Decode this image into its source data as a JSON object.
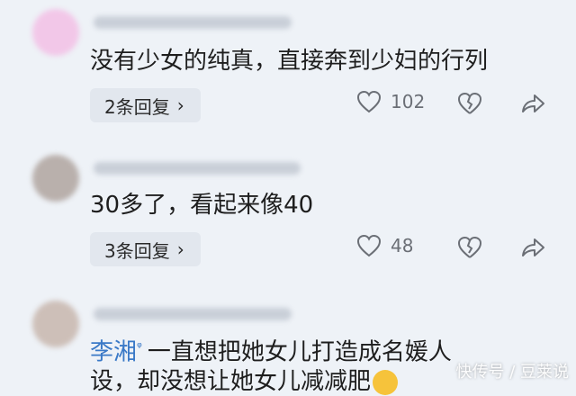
{
  "comments": [
    {
      "text": "没有少女的纯真，直接奔到少妇的行列",
      "reply_label": "2条回复",
      "likes": "102",
      "avatar_color": "#f2c7e8"
    },
    {
      "text": "30多了，看起来像40",
      "reply_label": "3条回复",
      "likes": "48",
      "avatar_color": "#b9b0ac"
    },
    {
      "username": "李湘",
      "badge": "ᵠ",
      "text_line1": "一直想把她女儿打造成名媛人",
      "text_line2": "设，却没想让她女儿减减肥",
      "avatar_color": "#cdbfb8"
    }
  ],
  "icons": {
    "like": "heart-outline-icon",
    "dislike": "broken-heart-icon",
    "share": "share-arrow-icon",
    "reply_chevron": "chevron-right-icon",
    "emoji": "laughing-emoji-icon"
  },
  "chevron": "›",
  "watermark": "快传号 / 豆莱说",
  "colors": {
    "background": "#eef2f7",
    "pill": "#e2e7ee",
    "username": "#3a79c7",
    "count": "#6b6f76"
  }
}
